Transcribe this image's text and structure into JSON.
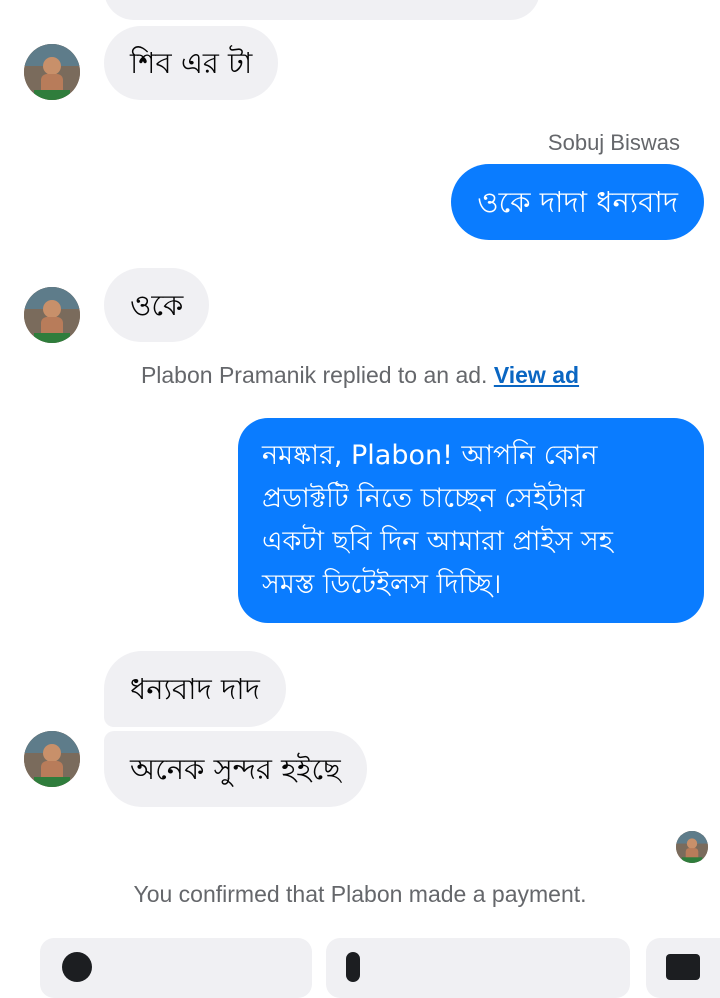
{
  "messages": {
    "m1_text": "শিব এর টা",
    "sender_name": "Sobuj Biswas",
    "m2_text": "ওকে দাদা ধন্যবাদ",
    "m3_text": "ওকে",
    "ad_notice": "Plabon Pramanik replied to an ad.",
    "ad_link": "View ad",
    "m4_lines": [
      "নমষ্কার, Plabon! আপনি কোন",
      "প্রডাক্টটি নিতে চাচ্ছেন সেইটার",
      "একটা ছবি দিন আমারা প্রাইস সহ",
      "সমস্ত ডিটেইলস দিচ্ছি।"
    ],
    "m5_text": "ধন্যবাদ দাদ",
    "m6_text": "অনেক সুন্দর হইছে"
  },
  "payment_notice": "You confirmed that Plabon made a payment.",
  "colors": {
    "outgoing_bubble": "#0a7cff",
    "incoming_bubble": "#f0f0f3",
    "meta_text": "#65676b",
    "link": "#0a66c2"
  },
  "icons": {
    "avatar": "user-avatar-photo",
    "seen": "seen-avatar-small"
  }
}
